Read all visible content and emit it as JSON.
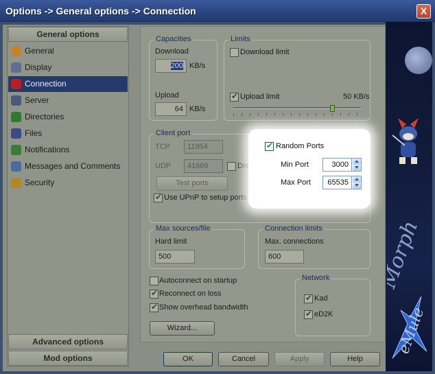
{
  "window": {
    "title": "Options -> General options -> Connection",
    "close_label": "X"
  },
  "sidebar": {
    "header_general": "General options",
    "items": [
      {
        "label": "General",
        "icon": "gear-icon",
        "color": "#c8821e"
      },
      {
        "label": "Display",
        "icon": "monitor-icon",
        "color": "#5f6f8f"
      },
      {
        "label": "Connection",
        "icon": "plug-icon",
        "color": "#b82020",
        "selected": true
      },
      {
        "label": "Server",
        "icon": "server-icon",
        "color": "#4a5a7a"
      },
      {
        "label": "Directories",
        "icon": "folder-icon",
        "color": "#2e7a2e"
      },
      {
        "label": "Files",
        "icon": "files-icon",
        "color": "#3a4a8a"
      },
      {
        "label": "Notifications",
        "icon": "bell-icon",
        "color": "#3a7a3a"
      },
      {
        "label": "Messages and Comments",
        "icon": "messages-icon",
        "color": "#4a6aa0"
      },
      {
        "label": "Security",
        "icon": "lock-icon",
        "color": "#b08a20"
      }
    ],
    "header_advanced": "Advanced options",
    "header_mod": "Mod options"
  },
  "capacities": {
    "caption": "Capacities",
    "download_label": "Download",
    "download_value": "200",
    "download_unit": "KB/s",
    "upload_label": "Upload",
    "upload_value": "64",
    "upload_unit": "KB/s"
  },
  "limits": {
    "caption": "Limits",
    "download_limit_label": "Download limit",
    "download_limit_checked": false,
    "upload_limit_label": "Upload limit",
    "upload_limit_checked": true,
    "upload_limit_value": "50 KB/s",
    "upload_slider_fraction": 0.78
  },
  "client_port": {
    "caption": "Client port",
    "tcp_label": "TCP",
    "tcp_value": "11954",
    "udp_label": "UDP",
    "udp_value": "41669",
    "disable_label": "Disable",
    "test_ports_label": "Test ports",
    "upnp_label": "Use UPnP to setup ports",
    "upnp_checked": true,
    "random_ports_label": "Random Ports",
    "random_ports_checked": true,
    "min_port_label": "Min Port",
    "min_port_value": "3000",
    "max_port_label": "Max Port",
    "max_port_value": "65535"
  },
  "max_sources": {
    "caption": "Max sources/file",
    "hard_limit_label": "Hard limit",
    "hard_limit_value": "500"
  },
  "connection_limits": {
    "caption": "Connection limits",
    "max_connections_label": "Max. connections",
    "max_connections_value": "600"
  },
  "options": {
    "autoconnect_label": "Autoconnect on startup",
    "autoconnect_checked": false,
    "reconnect_label": "Reconnect on loss",
    "reconnect_checked": true,
    "overhead_label": "Show overhead bandwidth",
    "overhead_checked": true,
    "wizard_label": "Wizard..."
  },
  "network": {
    "caption": "Network",
    "kad_label": "Kad",
    "kad_checked": true,
    "ed2k_label": "eD2K",
    "ed2k_checked": true
  },
  "footer": {
    "ok_label": "OK",
    "cancel_label": "Cancel",
    "apply_label": "Apply",
    "help_label": "Help"
  },
  "banner": {
    "brand_text": "eMule Morph"
  }
}
